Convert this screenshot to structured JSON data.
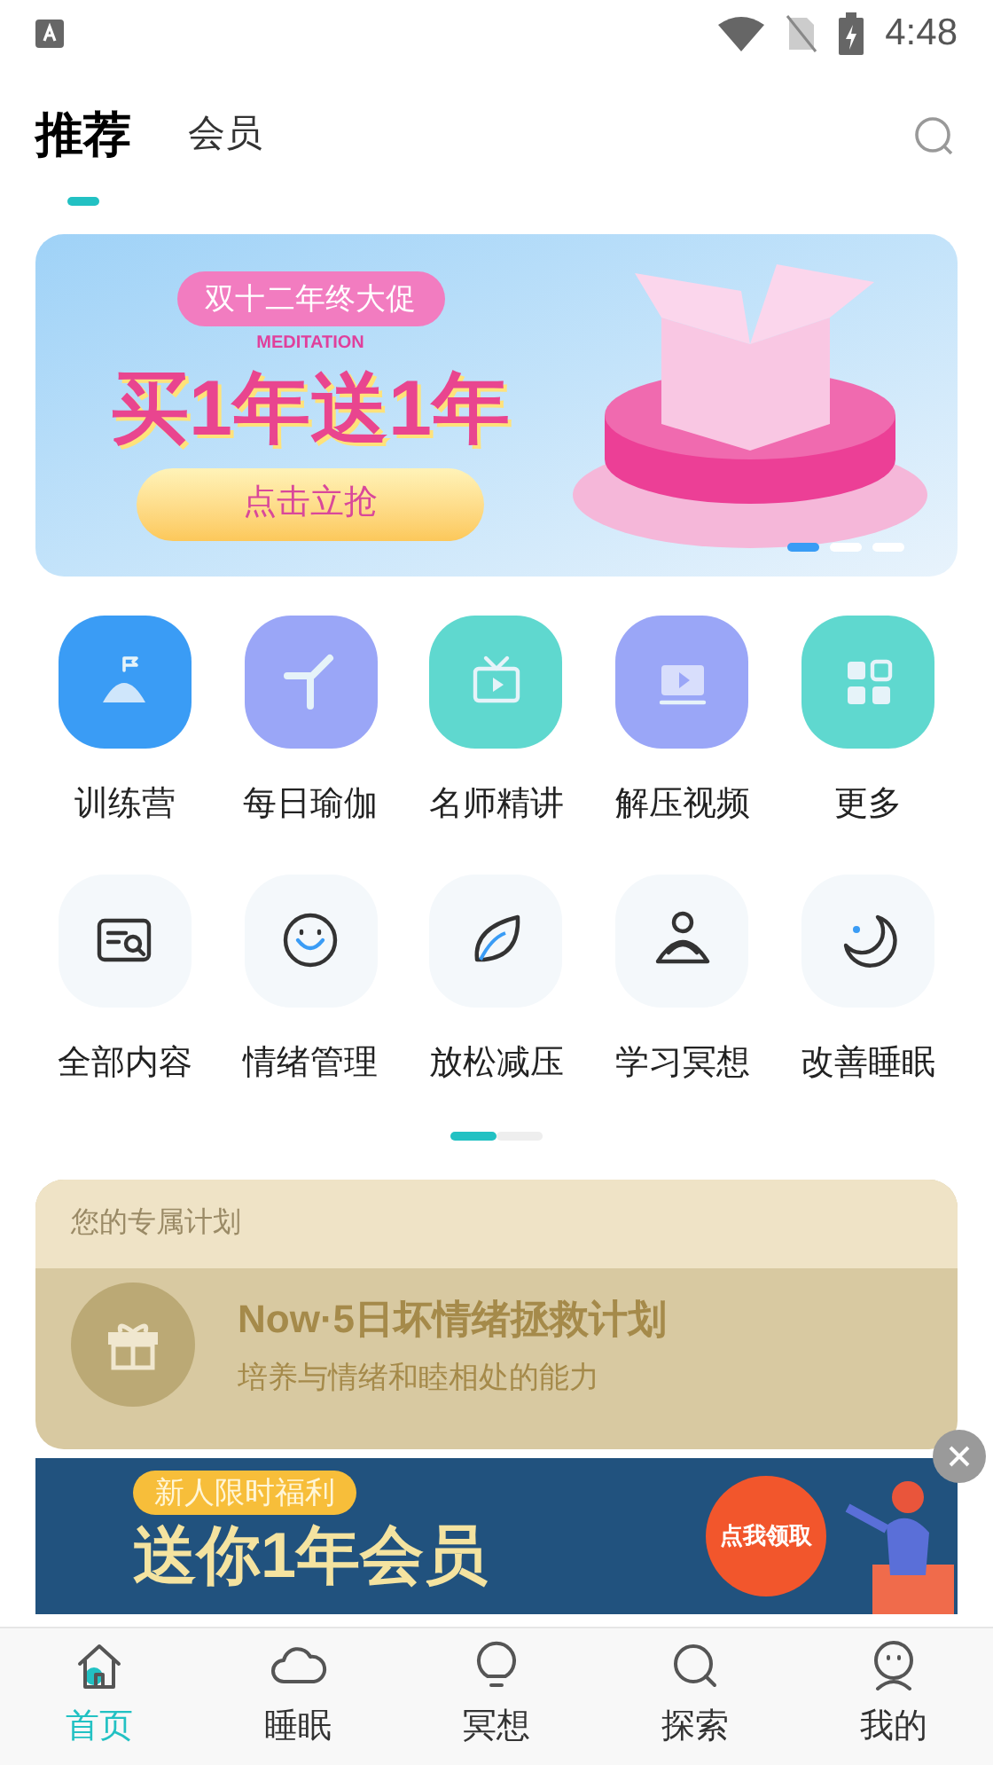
{
  "status_bar": {
    "time": "4:48"
  },
  "tabs": [
    {
      "label": "推荐",
      "selected": true
    },
    {
      "label": "会员",
      "selected": false
    }
  ],
  "banner": {
    "tag": "双十二年终大促",
    "subtitle": "MEDITATION",
    "headline": "买1年送1年",
    "button": "点击立抢",
    "dots": [
      {
        "selected": true
      },
      {
        "selected": false
      },
      {
        "selected": false
      }
    ]
  },
  "categories": [
    {
      "label": "训练营",
      "kind": "camp"
    },
    {
      "label": "每日瑜伽",
      "kind": "yoga"
    },
    {
      "label": "名师精讲",
      "kind": "tv"
    },
    {
      "label": "解压视频",
      "kind": "video"
    },
    {
      "label": "更多",
      "kind": "grid"
    },
    {
      "label": "全部内容",
      "kind": "search-card"
    },
    {
      "label": "情绪管理",
      "kind": "smile"
    },
    {
      "label": "放松减压",
      "kind": "leaf"
    },
    {
      "label": "学习冥想",
      "kind": "person"
    },
    {
      "label": "改善睡眠",
      "kind": "moon"
    }
  ],
  "category_pages": [
    {
      "selected": true
    },
    {
      "selected": false
    }
  ],
  "plan_card": {
    "title": "您的专属计划",
    "plan_name": "Now·5日坏情绪拯救计划",
    "plan_desc": "培养与情绪和睦相处的能力"
  },
  "popup_ad": {
    "tag": "新人限时福利",
    "headline": "送你1年会员",
    "button": "点我领取"
  },
  "bottom_nav": [
    {
      "label": "首页",
      "kind": "home",
      "selected": true
    },
    {
      "label": "睡眠",
      "kind": "cloud",
      "selected": false
    },
    {
      "label": "冥想",
      "kind": "bulb",
      "selected": false
    },
    {
      "label": "探索",
      "kind": "search",
      "selected": false
    },
    {
      "label": "我的",
      "kind": "face",
      "selected": false
    }
  ]
}
